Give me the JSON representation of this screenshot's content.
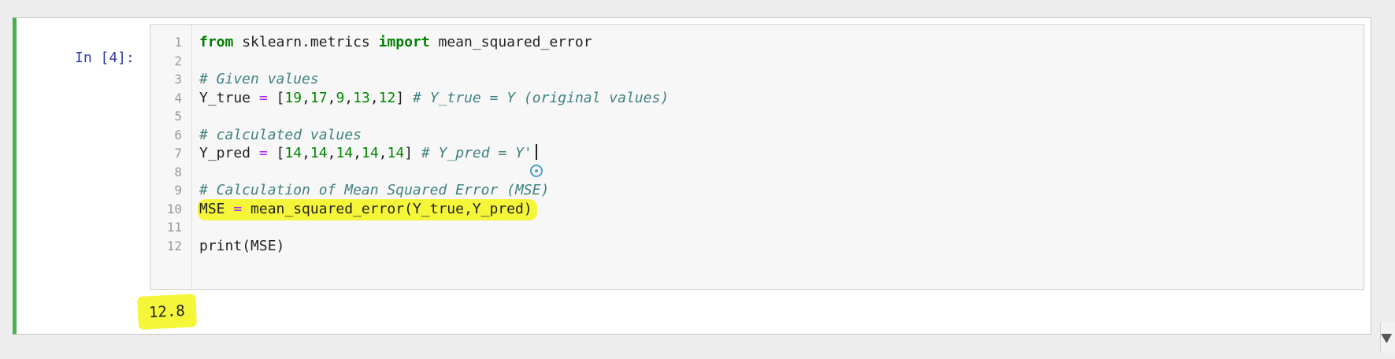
{
  "cell": {
    "prompt": "In [4]:",
    "lines": [
      {
        "num": "1",
        "tokens": [
          {
            "t": "from",
            "c": "kw"
          },
          {
            "t": " sklearn.metrics ",
            "c": ""
          },
          {
            "t": "import",
            "c": "kw"
          },
          {
            "t": " mean_squared_error",
            "c": ""
          }
        ]
      },
      {
        "num": "2",
        "tokens": []
      },
      {
        "num": "3",
        "tokens": [
          {
            "t": "# Given values",
            "c": "cm"
          }
        ]
      },
      {
        "num": "4",
        "tokens": [
          {
            "t": "Y_true ",
            "c": ""
          },
          {
            "t": "=",
            "c": "op"
          },
          {
            "t": " [",
            "c": ""
          },
          {
            "t": "19",
            "c": "num"
          },
          {
            "t": ",",
            "c": ""
          },
          {
            "t": "17",
            "c": "num"
          },
          {
            "t": ",",
            "c": ""
          },
          {
            "t": "9",
            "c": "num"
          },
          {
            "t": ",",
            "c": ""
          },
          {
            "t": "13",
            "c": "num"
          },
          {
            "t": ",",
            "c": ""
          },
          {
            "t": "12",
            "c": "num"
          },
          {
            "t": "] ",
            "c": ""
          },
          {
            "t": "# Y_true = Y (original values)",
            "c": "cm"
          }
        ]
      },
      {
        "num": "5",
        "tokens": []
      },
      {
        "num": "6",
        "tokens": [
          {
            "t": "# calculated values",
            "c": "cm"
          }
        ]
      },
      {
        "num": "7",
        "tokens": [
          {
            "t": "Y_pred ",
            "c": ""
          },
          {
            "t": "=",
            "c": "op"
          },
          {
            "t": " [",
            "c": ""
          },
          {
            "t": "14",
            "c": "num"
          },
          {
            "t": ",",
            "c": ""
          },
          {
            "t": "14",
            "c": "num"
          },
          {
            "t": ",",
            "c": ""
          },
          {
            "t": "14",
            "c": "num"
          },
          {
            "t": ",",
            "c": ""
          },
          {
            "t": "14",
            "c": "num"
          },
          {
            "t": ",",
            "c": ""
          },
          {
            "t": "14",
            "c": "num"
          },
          {
            "t": "] ",
            "c": ""
          },
          {
            "t": "# Y_pred = Y'",
            "c": "cm"
          }
        ],
        "cursor": true
      },
      {
        "num": "8",
        "tokens": []
      },
      {
        "num": "9",
        "tokens": [
          {
            "t": "# Calculation of Mean Squared Error (MSE)",
            "c": "cm"
          }
        ]
      },
      {
        "num": "10",
        "highlight": true,
        "tokens": [
          {
            "t": "MSE ",
            "c": ""
          },
          {
            "t": "=",
            "c": "op"
          },
          {
            "t": " mean_squared_error(Y_true,Y_pred)",
            "c": ""
          }
        ]
      },
      {
        "num": "11",
        "tokens": []
      },
      {
        "num": "12",
        "tokens": [
          {
            "t": "print",
            "c": ""
          },
          {
            "t": "(MSE)",
            "c": ""
          }
        ]
      }
    ],
    "output": "12.8"
  },
  "colors": {
    "cell_border_active": "#4caf50",
    "highlight": "#f5f53a",
    "keyword": "#008000",
    "comment": "#408080",
    "number": "#008800",
    "operator": "#aa22ff",
    "prompt": "#303f9f"
  },
  "icons": {
    "cursor_target": "target-icon",
    "corner": "pointer-arrow-icon"
  }
}
